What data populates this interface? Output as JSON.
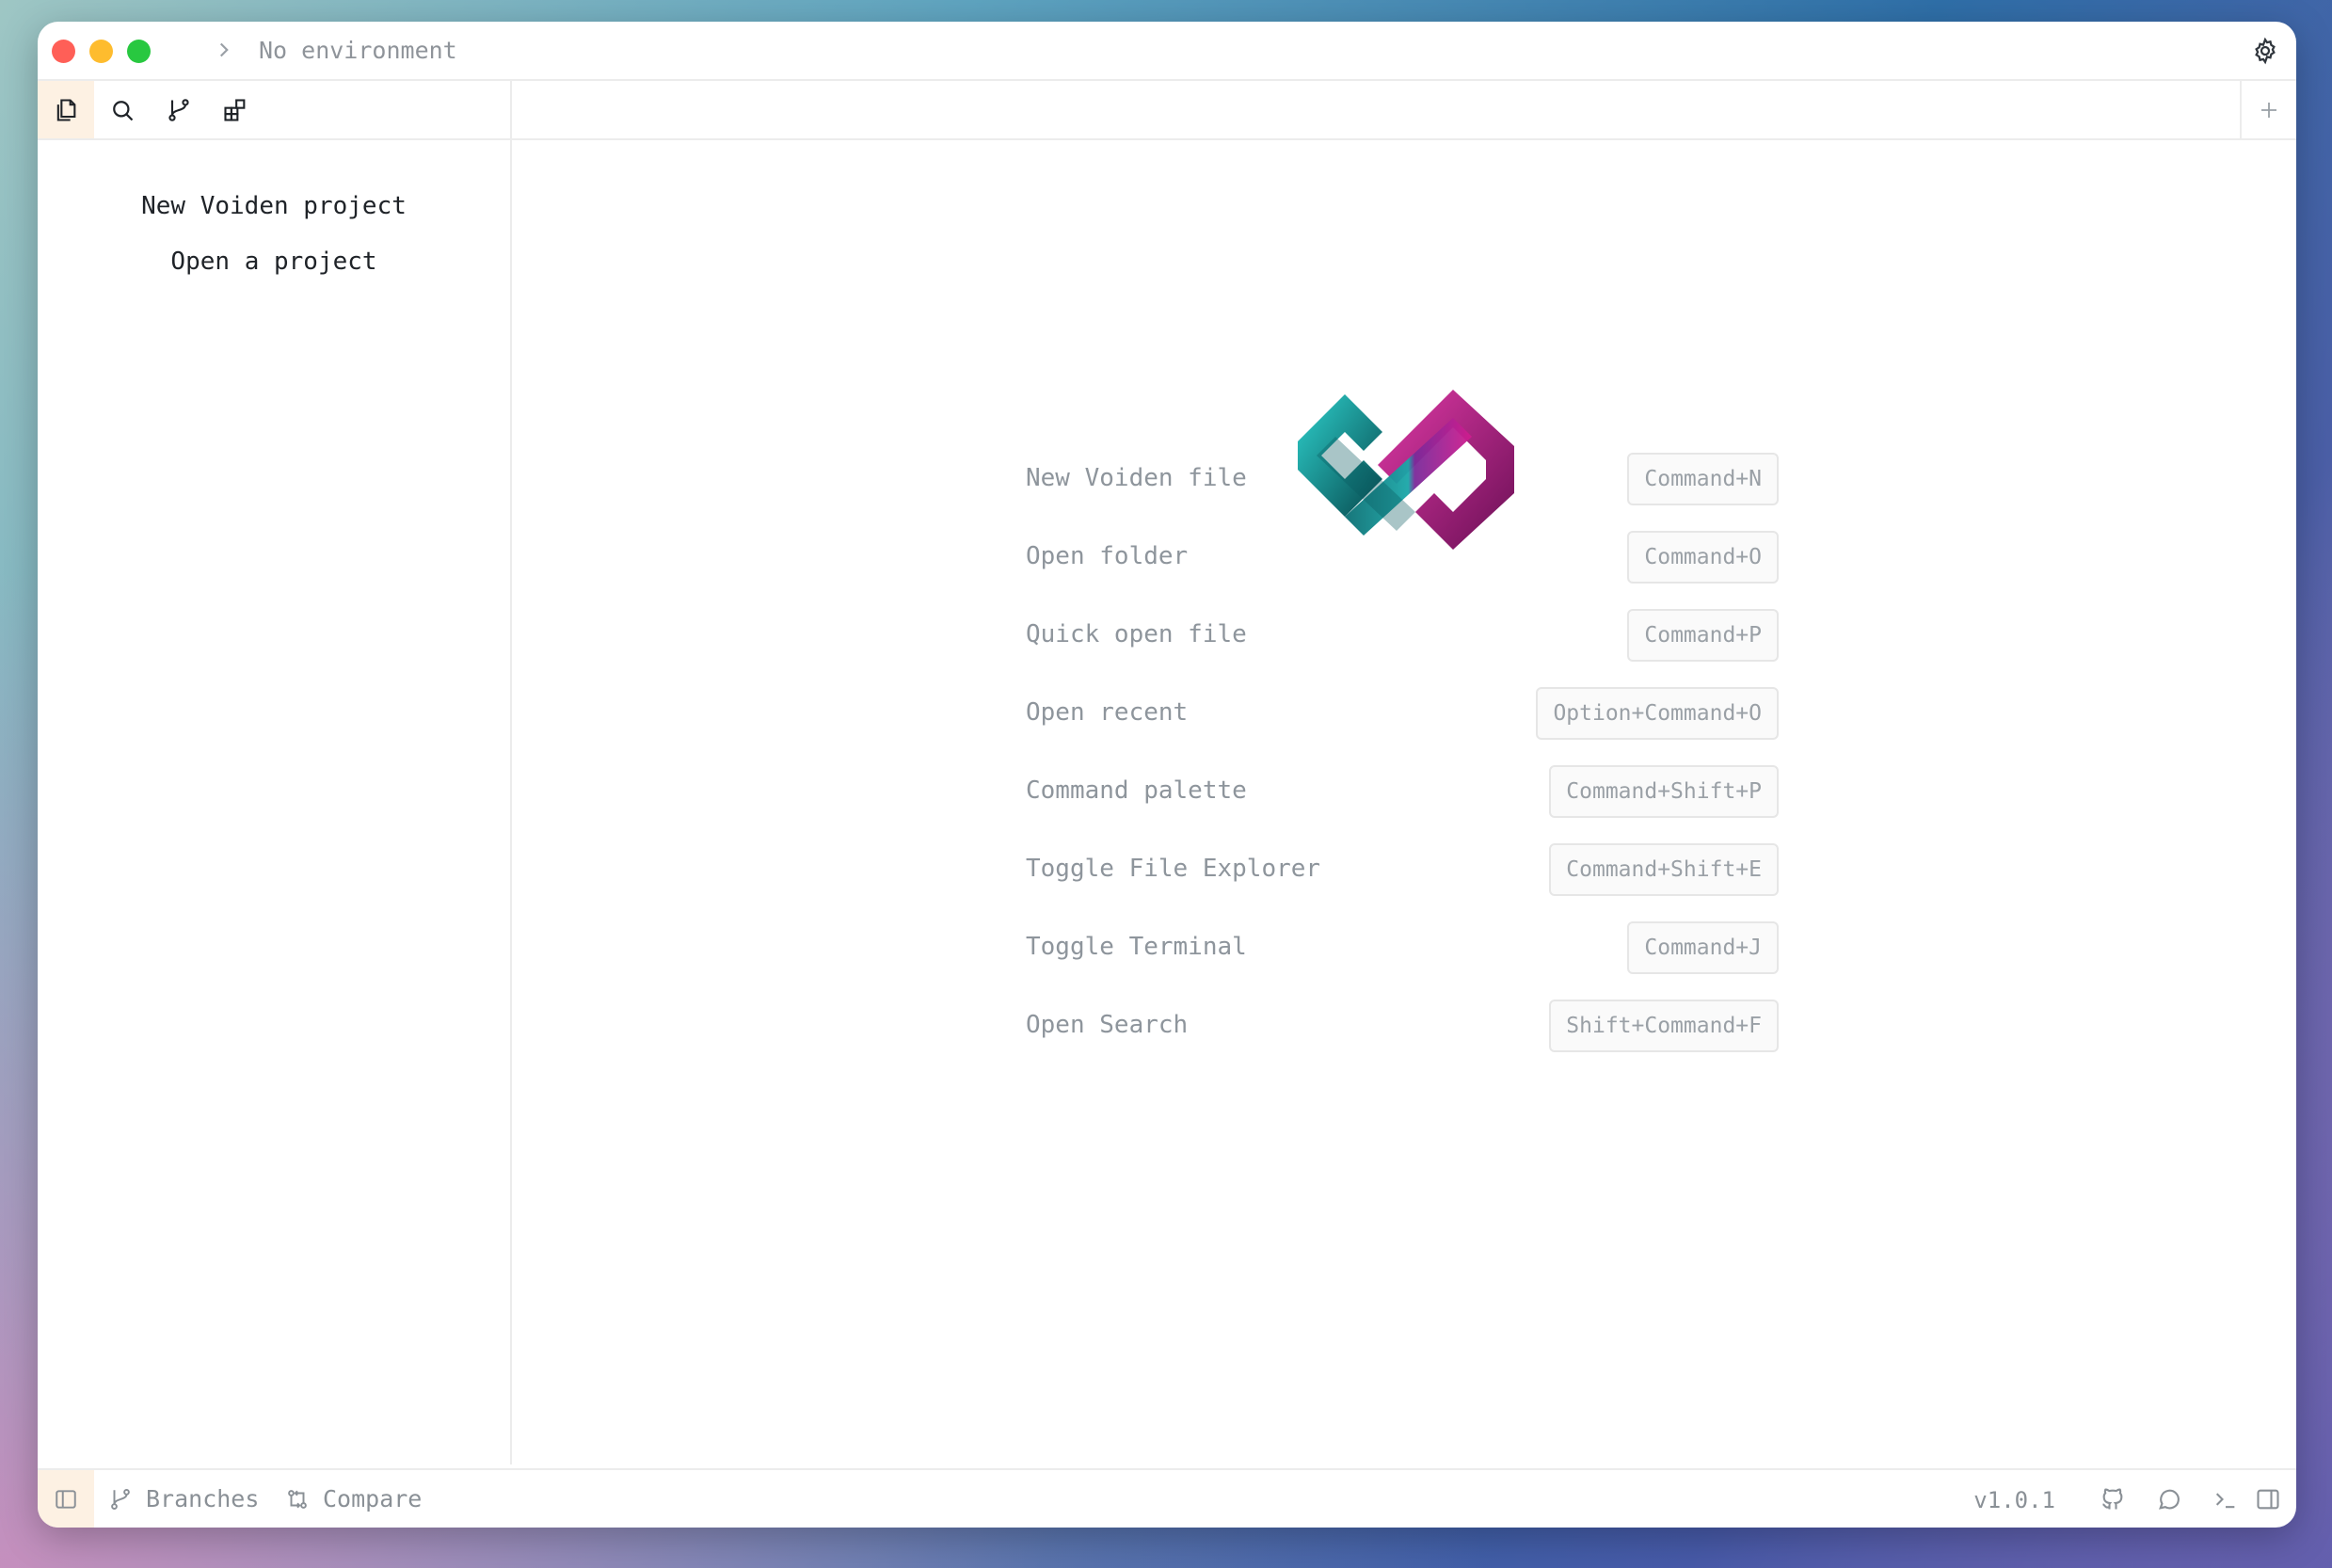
{
  "titlebar": {
    "environment_label": "No environment",
    "icons": {
      "chevron": "chevron-right-icon",
      "settings": "gear-icon"
    }
  },
  "sidebar": {
    "tools": [
      "files-icon",
      "search-icon",
      "git-branch-icon",
      "extensions-icon"
    ],
    "links": [
      "New Voiden project",
      "Open a project"
    ]
  },
  "main": {
    "logo": "voiden-infinity-logo",
    "shortcuts": [
      {
        "label": "New Voiden file",
        "key": "Command+N"
      },
      {
        "label": "Open folder",
        "key": "Command+O"
      },
      {
        "label": "Quick open file",
        "key": "Command+P"
      },
      {
        "label": "Open recent",
        "key": "Option+Command+O"
      },
      {
        "label": "Command palette",
        "key": "Command+Shift+P"
      },
      {
        "label": "Toggle File Explorer",
        "key": "Command+Shift+E"
      },
      {
        "label": "Toggle Terminal",
        "key": "Command+J"
      },
      {
        "label": "Open Search",
        "key": "Shift+Command+F"
      }
    ]
  },
  "statusbar": {
    "branches_label": "Branches",
    "compare_label": "Compare",
    "version": "v1.0.1",
    "icons": [
      "sidebar-toggle-icon",
      "github-icon",
      "chat-icon",
      "terminal-icon",
      "panel-right-icon"
    ]
  },
  "colors": {
    "accent_active": "#fdf1e3",
    "logo_teal": "#0e8c8c",
    "logo_magenta": "#c2178f"
  }
}
